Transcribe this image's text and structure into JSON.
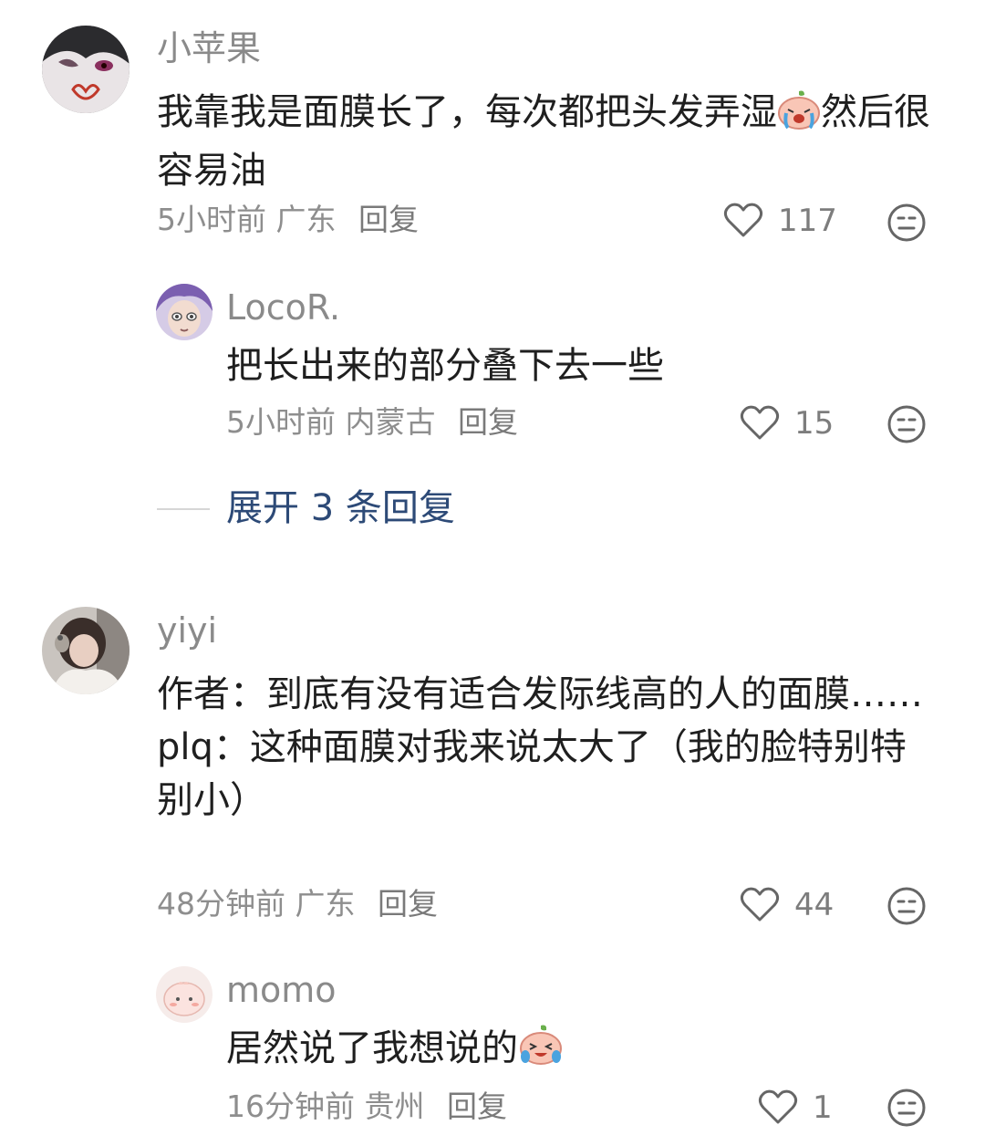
{
  "comments": [
    {
      "username": "小苹果",
      "text_before": "我靠我是面膜长了，每次都把头发弄湿",
      "text_after": "然后很容易油",
      "time": "5小时前",
      "location": "广东",
      "reply_label": "回复",
      "likes": "117",
      "replies": [
        {
          "username": "LocoR.",
          "text": "把长出来的部分叠下去一些",
          "time": "5小时前",
          "location": "内蒙古",
          "reply_label": "回复",
          "likes": "15"
        }
      ],
      "expand_label": "展开 3 条回复"
    },
    {
      "username": "yiyi",
      "text_line1": "作者：到底有没有适合发际线高的人的面膜……",
      "text_line2": "plq：这种面膜对我来说太大了（我的脸特别特别小）",
      "time": "48分钟前",
      "location": "广东",
      "reply_label": "回复",
      "likes": "44",
      "replies": [
        {
          "username": "momo",
          "text": "居然说了我想说的",
          "time": "16分钟前",
          "location": "贵州",
          "reply_label": "回复",
          "likes": "1"
        }
      ]
    }
  ],
  "icons": {
    "like": "heart-outline-icon",
    "dislike": "meh-face-icon",
    "emoji1": "crying-peach-emoji",
    "emoji2": "laughing-crying-peach-emoji"
  },
  "colors": {
    "expand_text": "#2d4a77",
    "meta_text": "#8e8e8e"
  }
}
